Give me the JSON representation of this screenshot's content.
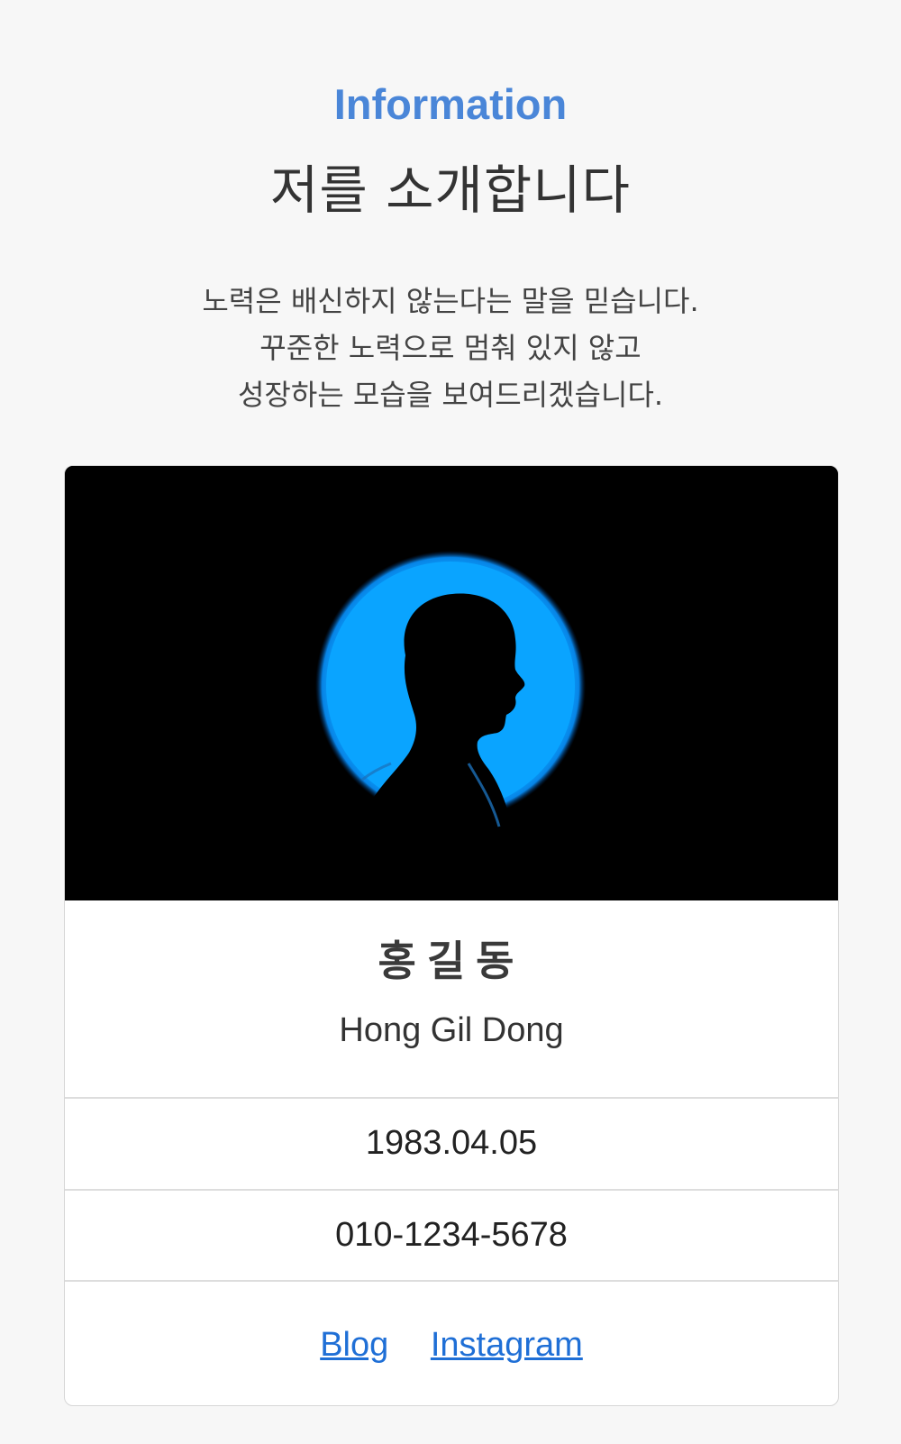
{
  "header": {
    "section_label": "Information",
    "title": "저를 소개합니다"
  },
  "intro": {
    "lines": [
      "노력은 배신하지 않는다는 말을 믿습니다.",
      "꾸준한 노력으로 멈춰 있지 않고",
      "성장하는 모습을 보여드리겠습니다."
    ]
  },
  "profile": {
    "photo_icon": "person-silhouette",
    "name_kr": "홍길동",
    "name_en": "Hong Gil Dong",
    "birthdate": "1983.04.05",
    "phone": "010-1234-5678",
    "links": {
      "blog": "Blog",
      "instagram": "Instagram"
    }
  },
  "colors": {
    "accent": "#4a86d8",
    "link": "#1f6fd6",
    "photo_glow": "#0aa4ff",
    "background": "#f7f7f7"
  }
}
